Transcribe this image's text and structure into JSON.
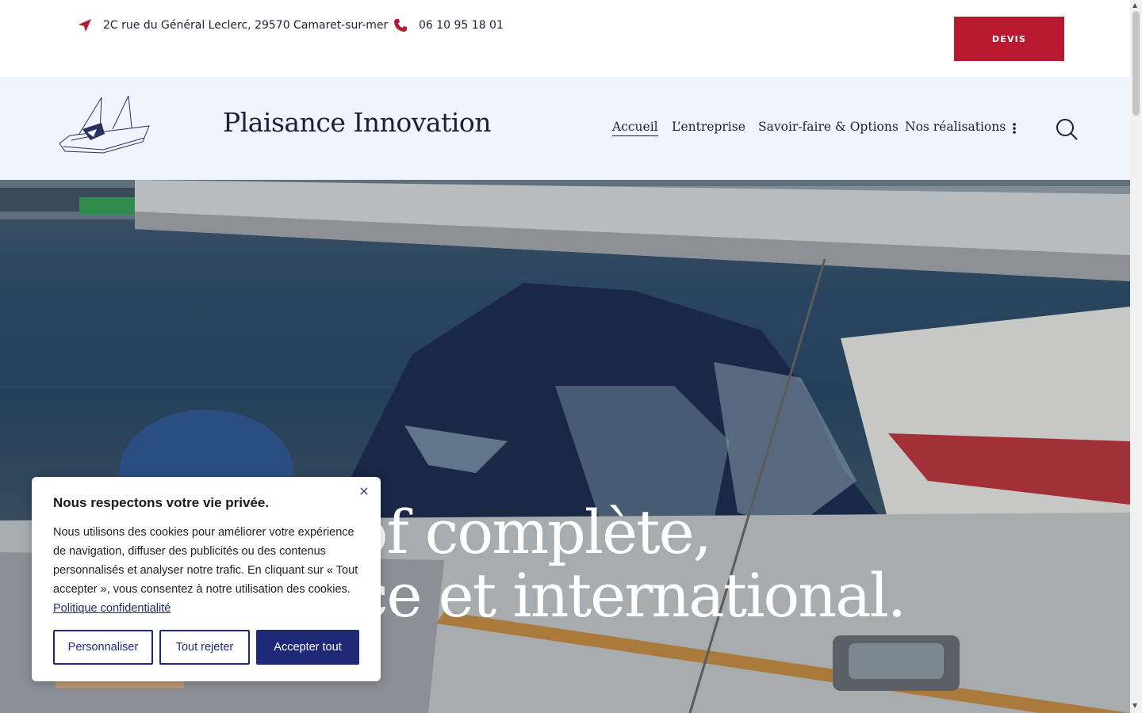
{
  "topbar": {
    "address": "2C rue du Général Leclerc, 29570 Camaret-sur-mer",
    "phone": "06 10 95 18 01",
    "devis_label": "DEVIS"
  },
  "header": {
    "brand": "Plaisance Innovation",
    "nav": [
      {
        "label": "Accueil",
        "active": true
      },
      {
        "label": "L’entreprise"
      },
      {
        "label": "Savoir-faire & Options"
      },
      {
        "label": "Nos réalisations"
      }
    ]
  },
  "hero": {
    "heading": "oof complète,\nnce et international."
  },
  "cookie": {
    "title": "Nous respectons votre vie privée.",
    "text": "Nous utilisons des cookies pour améliorer votre expérience de navigation, diffuser des publicités ou des contenus personnalisés et analyser notre trafic. En cliquant sur « Tout accepter », vous consentez à notre utilisation des cookies.",
    "link": "Politique confidentialité",
    "btn_custom": "Personnaliser",
    "btn_reject": "Tout rejeter",
    "btn_accept": "Accepter tout",
    "close_glyph": "×"
  },
  "colors": {
    "accent_red": "#b8192f",
    "navy": "#1e2a78",
    "header_bg": "#eef5fc"
  }
}
